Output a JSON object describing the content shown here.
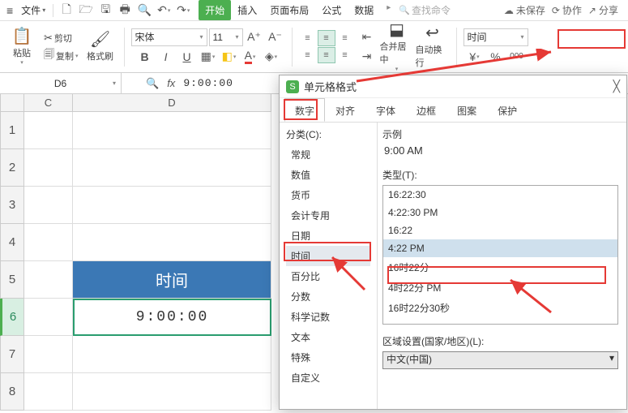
{
  "menubar": {
    "file": "文件",
    "search_hint": "查找命令",
    "unsaved": "未保存",
    "coop": "协作",
    "share": "分享",
    "tabs": [
      "开始",
      "插入",
      "页面布局",
      "公式",
      "数据"
    ]
  },
  "ribbon": {
    "paste": "粘贴",
    "cut": "剪切",
    "copy": "复制",
    "format_painter": "格式刷",
    "font": "宋体",
    "font_size": "11",
    "merge": "合并居中",
    "wrap": "自动换行",
    "number_format": "时间"
  },
  "fx": {
    "cell_ref": "D6",
    "value": "9:00:00"
  },
  "grid": {
    "columns": [
      "C",
      "D"
    ],
    "rows": [
      "1",
      "2",
      "3",
      "4",
      "5",
      "6",
      "7",
      "8"
    ],
    "d5": "时间",
    "d6": "9:00:00"
  },
  "dialog": {
    "title": "单元格格式",
    "tabs": [
      "数字",
      "对齐",
      "字体",
      "边框",
      "图案",
      "保护"
    ],
    "category_label": "分类(C):",
    "categories": [
      "常规",
      "数值",
      "货币",
      "会计专用",
      "日期",
      "时间",
      "百分比",
      "分数",
      "科学记数",
      "文本",
      "特殊",
      "自定义"
    ],
    "sample_label": "示例",
    "sample_value": "9:00 AM",
    "type_label": "类型(T):",
    "types": [
      "16:22:30",
      "4:22:30 PM",
      "16:22",
      "4:22 PM",
      "16时22分",
      "4时22分 PM",
      "16时22分30秒"
    ],
    "locale_label": "区域设置(国家/地区)(L):",
    "locale_value": "中文(中国)"
  }
}
